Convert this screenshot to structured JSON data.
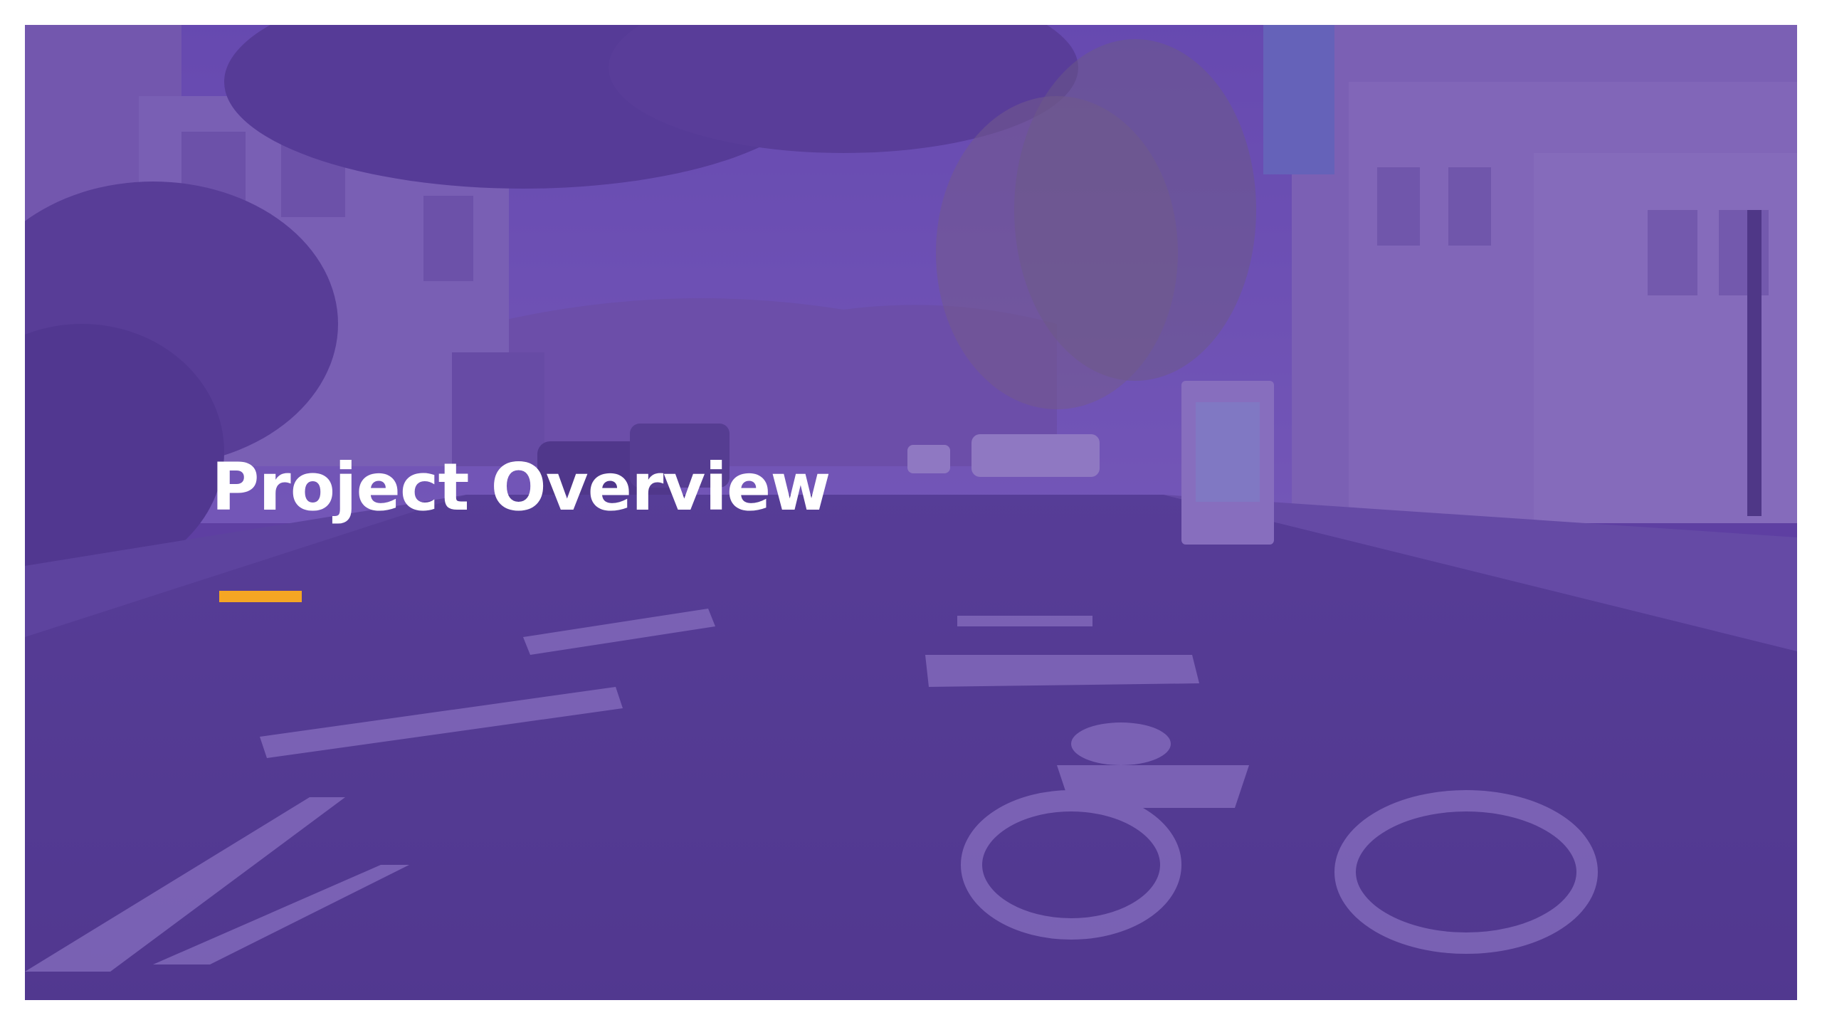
{
  "slide": {
    "title": "Project Overview",
    "background_image": "street-scene-bike-boulevard",
    "overlay_color": "#6040aa",
    "accent_color": "#f5a623",
    "title_color": "#ffffff"
  }
}
